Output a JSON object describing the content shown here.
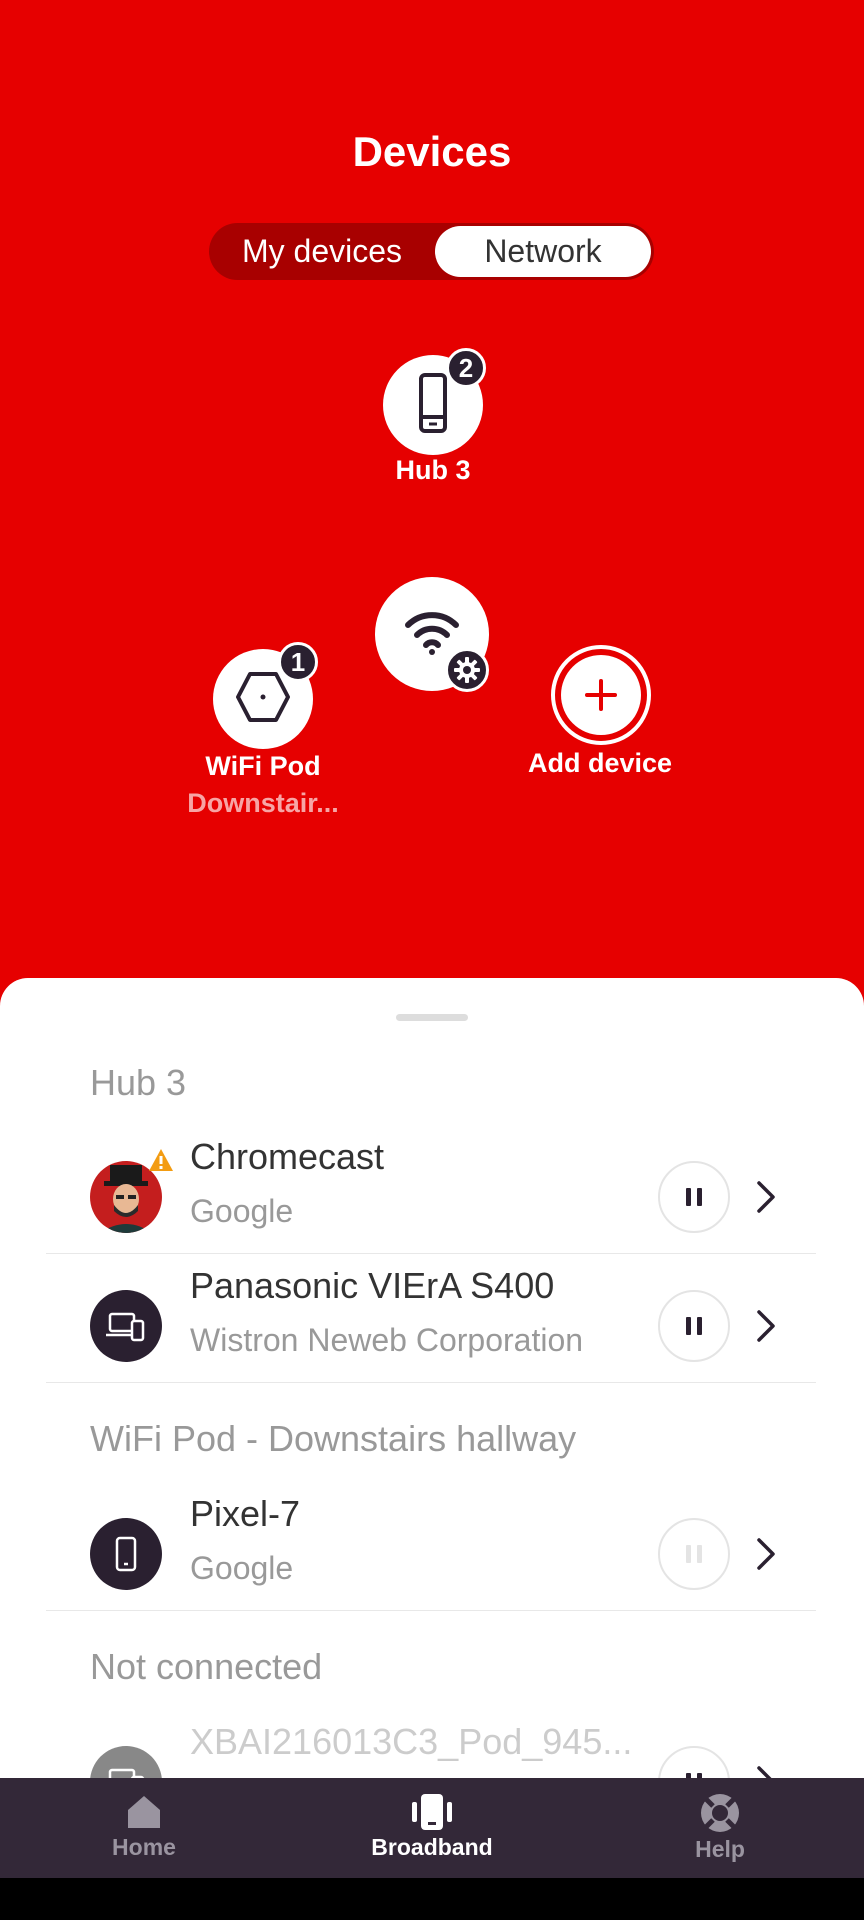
{
  "header": {
    "title": "Devices"
  },
  "segmented": {
    "my_devices": "My devices",
    "network": "Network",
    "selected": "Network"
  },
  "topology": {
    "hub": {
      "label": "Hub 3",
      "count": "2",
      "icon": "hub-device-icon"
    },
    "router": {
      "icon": "wifi-settings-icon"
    },
    "pod": {
      "label": "WiFi Pod",
      "sublabel": "Downstair...",
      "count": "1",
      "icon": "hexagon-pod-icon"
    },
    "add": {
      "label": "Add device",
      "icon": "plus-icon"
    }
  },
  "sections": [
    {
      "title": "Hub 3",
      "devices": [
        {
          "name": "Chromecast",
          "maker": "Google",
          "avatar": "user-avatar-photo",
          "warning": true
        },
        {
          "name": "Panasonic VIErA S400",
          "maker": "Wistron Neweb Corporation",
          "avatar": "laptop-phone-icon"
        }
      ]
    },
    {
      "title": "WiFi Pod - Downstairs hallway",
      "devices": [
        {
          "name": "Pixel-7",
          "maker": "Google",
          "avatar": "smartphone-icon",
          "pause_disabled": true
        }
      ]
    },
    {
      "title": "Not connected",
      "devices": [
        {
          "name": "XBAI216013C3_Pod_945...",
          "avatar": "laptop-phone-icon"
        }
      ]
    }
  ],
  "nav": {
    "items": [
      {
        "label": "Home",
        "icon": "home-icon"
      },
      {
        "label": "Broadband",
        "icon": "broadband-icon",
        "active": true
      },
      {
        "label": "Help",
        "icon": "lifebuoy-icon"
      }
    ]
  },
  "colors": {
    "brand_red": "#e60000",
    "dark": "#2a2030",
    "nav_bg": "#332838",
    "warning": "#f39c12"
  }
}
